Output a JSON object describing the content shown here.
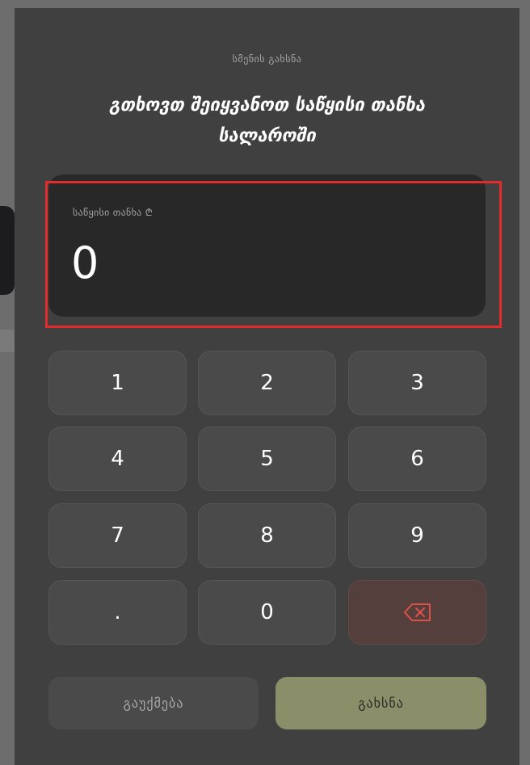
{
  "modal": {
    "subtitle": "სმენის გახსნა",
    "title": "გთხოვთ შეიყვანოთ საწყისი თანხა სალაროში"
  },
  "amount": {
    "label": "საწყისი თანხა ₾",
    "value": "0"
  },
  "keypad": {
    "keys": [
      "1",
      "2",
      "3",
      "4",
      "5",
      "6",
      "7",
      "8",
      "9",
      ".",
      "0"
    ],
    "backspace_icon": "backspace-icon"
  },
  "actions": {
    "cancel_label": "გაუქმება",
    "open_label": "გახსნა"
  },
  "colors": {
    "accent": "#8a8f69",
    "highlight": "#e22b2b",
    "backspace": "#e0504a"
  }
}
